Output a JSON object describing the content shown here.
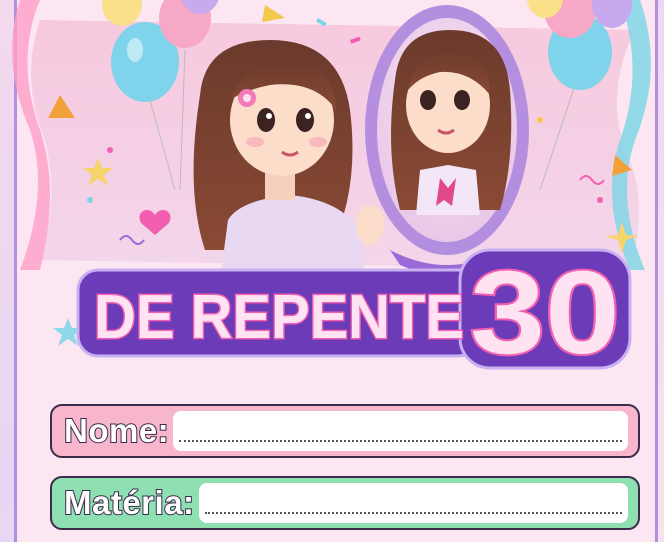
{
  "title": {
    "main": "DE REPENTE",
    "number": "30"
  },
  "form": {
    "name_label": "Nome:",
    "subject_label": "Matéria:"
  },
  "colors": {
    "neon_pink": "#f25fb0",
    "neon_purple": "#7a3fc4",
    "name_field": "#f7b6cc",
    "subject_field": "#8ee0b2"
  },
  "illustration": {
    "description_icons": [
      "balloons-icon",
      "mirror-icon",
      "star-icon",
      "heart-icon",
      "confetti-icon"
    ]
  }
}
